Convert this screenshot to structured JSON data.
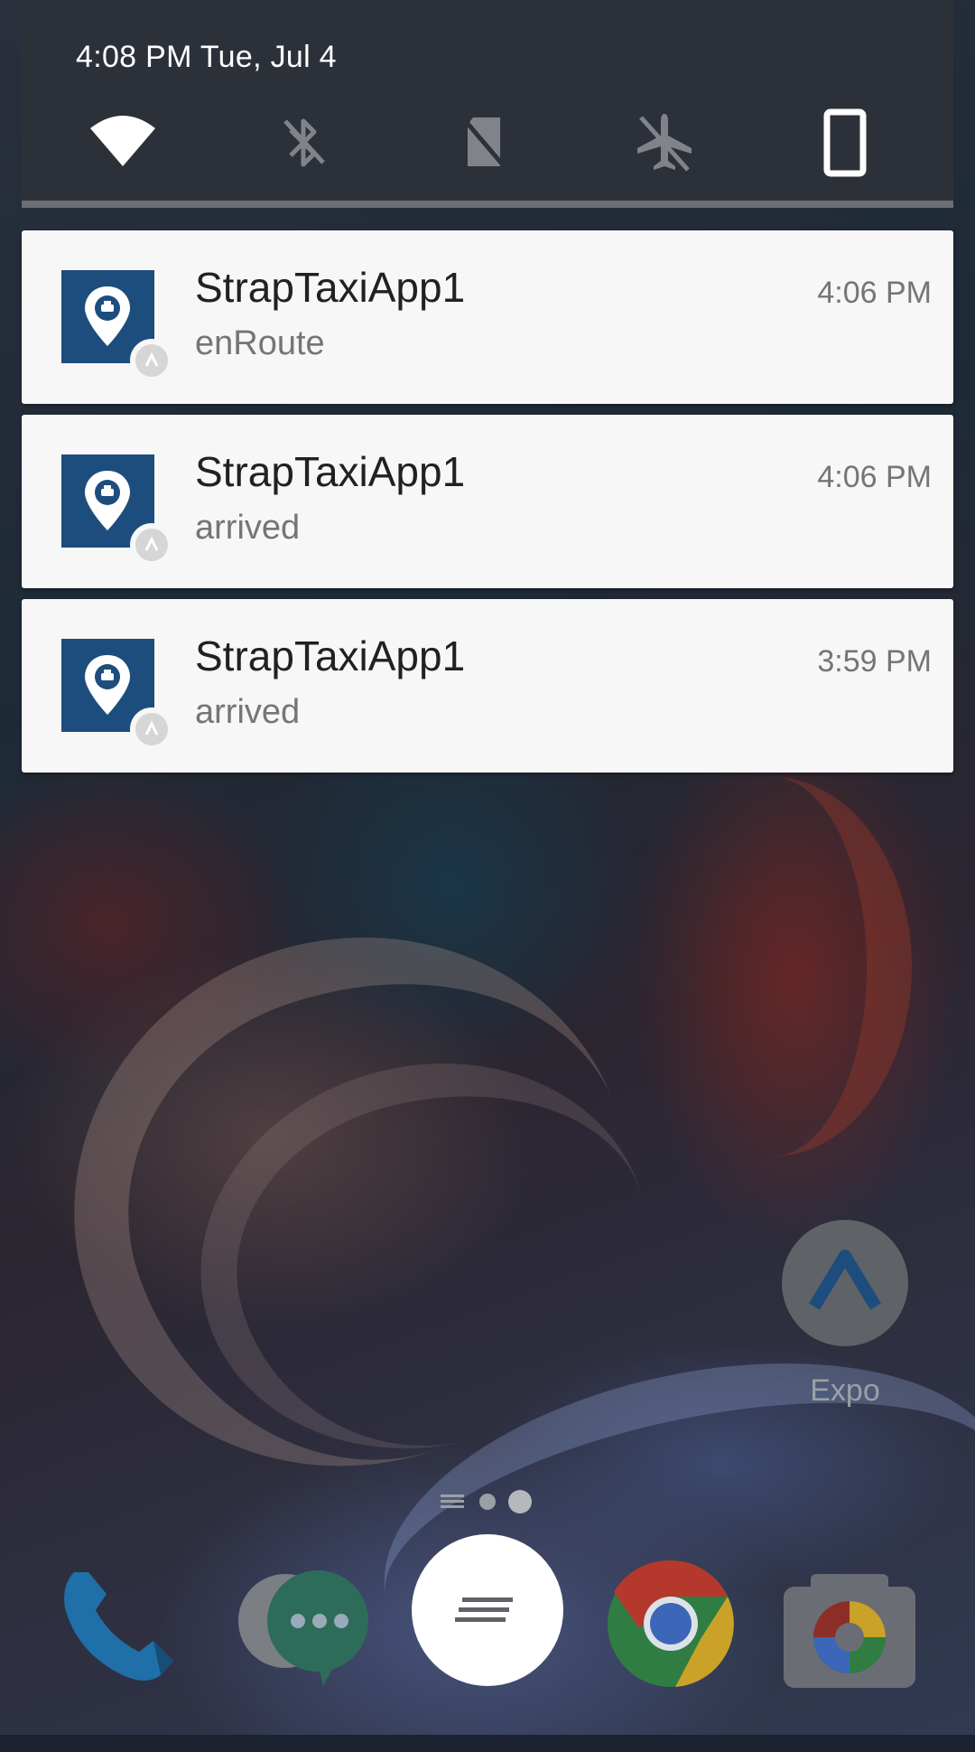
{
  "quick_settings": {
    "datetime": "4:08 PM  Tue, Jul 4",
    "tiles": [
      {
        "icon": "wifi-icon",
        "active": true
      },
      {
        "icon": "bluetooth-off-icon",
        "active": false
      },
      {
        "icon": "mobile-data-off-icon",
        "active": false
      },
      {
        "icon": "airplane-mode-icon",
        "active": false
      },
      {
        "icon": "auto-rotate-icon",
        "active": true
      }
    ]
  },
  "notifications": [
    {
      "app": "StrapTaxiApp1",
      "text": "enRoute",
      "time": "4:06 PM"
    },
    {
      "app": "StrapTaxiApp1",
      "text": "arrived",
      "time": "4:06 PM"
    },
    {
      "app": "StrapTaxiApp1",
      "text": "arrived",
      "time": "3:59 PM"
    }
  ],
  "home": {
    "expo_label": "Expo",
    "dock": [
      "phone-icon",
      "messages-icon",
      "app-drawer-icon",
      "chrome-icon",
      "camera-icon"
    ]
  },
  "colors": {
    "app_icon_bg": "#1d4d7c",
    "qs_bg": "#2c3139",
    "card_bg": "#f7f7f7"
  }
}
